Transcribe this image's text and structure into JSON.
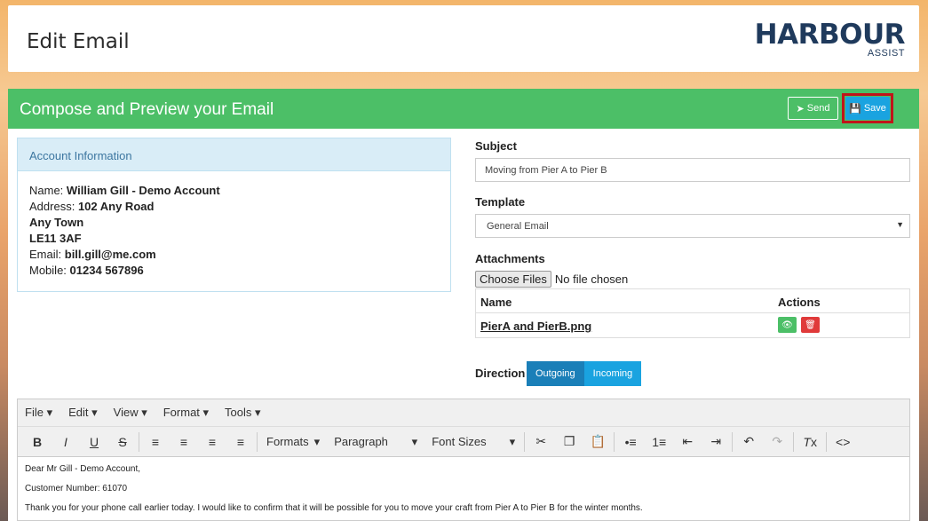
{
  "header": {
    "title": "Edit Email",
    "logo_word": "HARBOUR",
    "logo_sub": "ASSIST"
  },
  "panel": {
    "title": "Compose and Preview your Email",
    "send_label": "Send",
    "save_label": "Save"
  },
  "account": {
    "heading": "Account Information",
    "name_label": "Name:",
    "name": "William Gill - Demo Account",
    "address_label": "Address:",
    "address1": "102 Any Road",
    "address2": "Any Town",
    "postcode": "LE11 3AF",
    "email_label": "Email:",
    "email": "bill.gill@me.com",
    "mobile_label": "Mobile:",
    "mobile": "01234 567896"
  },
  "subject": {
    "label": "Subject",
    "value": "Moving from Pier A to Pier B"
  },
  "template": {
    "label": "Template",
    "value": "General Email"
  },
  "attachments": {
    "label": "Attachments",
    "choose_label": "Choose Files",
    "no_file": "No file chosen",
    "col_name": "Name",
    "col_actions": "Actions",
    "rows": [
      {
        "name": "PierA and PierB.png"
      }
    ]
  },
  "direction": {
    "label": "Direction",
    "options": [
      "Outgoing",
      "Incoming"
    ],
    "selected": "Outgoing"
  },
  "editor": {
    "menus": [
      "File",
      "Edit",
      "View",
      "Format",
      "Tools"
    ],
    "formats_label": "Formats",
    "paragraph_label": "Paragraph",
    "font_sizes_label": "Font Sizes",
    "body": [
      "Dear Mr Gill - Demo Account,",
      "Customer Number: 61070",
      "Thank you for your phone call earlier today.  I would like to confirm that it will be possible for you to move your craft from Pier A to Pier B for the winter months."
    ]
  },
  "colors": {
    "green": "#4cbf67",
    "blue": "#1aa3e0",
    "highlight": "#c0141a"
  }
}
